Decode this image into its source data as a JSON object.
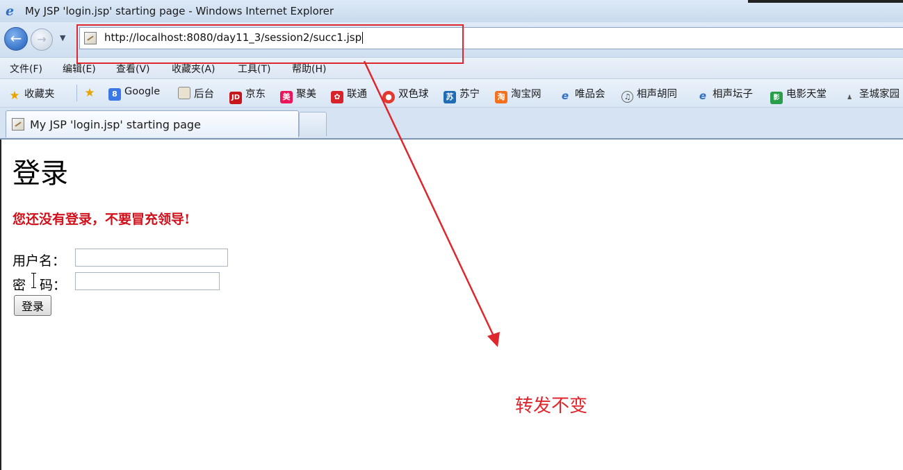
{
  "window": {
    "title": "My JSP 'login.jsp' starting page - Windows Internet Explorer"
  },
  "navigation": {
    "url": "http://localhost:8080/day11_3/session2/succ1.jsp"
  },
  "menu": [
    "文件(F)",
    "编辑(E)",
    "查看(V)",
    "收藏夹(A)",
    "工具(T)",
    "帮助(H)"
  ],
  "favorites": {
    "label": "收藏夹",
    "items": [
      "Google",
      "后台",
      "京东",
      "聚美",
      "联通",
      "双色球",
      "苏宁",
      "淘宝网",
      "唯品会",
      "相声胡同",
      "相声坛子",
      "电影天堂",
      "圣城家园"
    ]
  },
  "tab": {
    "title": "My JSP 'login.jsp' starting page"
  },
  "page": {
    "heading": "登录",
    "warning": "您还没有登录，不要冒充领导!",
    "username_label": "用户名：",
    "password_label_1": "密",
    "password_label_2": "码：",
    "submit_label": "登录"
  },
  "annotation": {
    "text": "转发不变",
    "color": "#e0262d"
  }
}
